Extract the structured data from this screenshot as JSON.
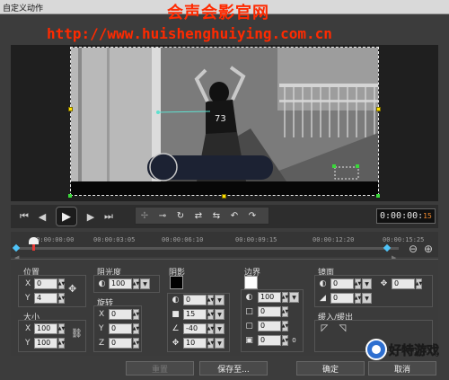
{
  "window": {
    "title": "自定义动作"
  },
  "watermark": {
    "line1": "会声会影官网",
    "line2": "http://www.huishenghuiying.com.cn"
  },
  "preview": {
    "shirt_text": "73"
  },
  "controls": {
    "buttons": [
      "go-start-icon",
      "prev-frame-icon",
      "play-icon",
      "next-frame-icon",
      "go-end-icon"
    ],
    "keyframe_buttons": [
      "add-keyframe-icon",
      "remove-keyframe-icon",
      "reverse-icon",
      "move-left-icon",
      "move-right-icon",
      "prev-keyframe-icon",
      "next-keyframe-icon"
    ],
    "timecode": "0:00:00:",
    "timecode_frame": "15"
  },
  "ruler": {
    "ticks": [
      "00:00:00:00",
      "00:00:03:05",
      "00:00:06:10",
      "00:00:09:15",
      "00:00:12:20",
      "00:00:15:25"
    ]
  },
  "position": {
    "label": "位置",
    "x_label": "X",
    "x_value": "0",
    "y_label": "Y",
    "y_value": "4"
  },
  "size": {
    "label": "大小",
    "x_label": "X",
    "x_value": "100",
    "y_label": "Y",
    "y_value": "100"
  },
  "opacity": {
    "label": "阻光度",
    "value": "100"
  },
  "rotation": {
    "label": "旋转",
    "x_label": "X",
    "x_value": "0",
    "y_label": "Y",
    "y_value": "0",
    "z_label": "Z",
    "z_value": "0"
  },
  "shadow": {
    "label": "阴影",
    "values": [
      "0",
      "15",
      "-40",
      "10"
    ]
  },
  "border": {
    "label": "边界",
    "values": [
      "100",
      "0",
      "0",
      "0",
      "0"
    ]
  },
  "mirror": {
    "label": "镜面",
    "values": [
      "0",
      "0",
      "0"
    ],
    "side_value": "0"
  },
  "fade": {
    "label": "缓入/缓出"
  },
  "footer": {
    "reset": "重置",
    "save": "保存至...",
    "ok": "确定",
    "cancel": "取消"
  },
  "logo": {
    "text": "好特游戏"
  },
  "colors": {
    "accent": "#ff2a00",
    "handle": "#ffe100",
    "keyframe": "#4fc3f7"
  }
}
